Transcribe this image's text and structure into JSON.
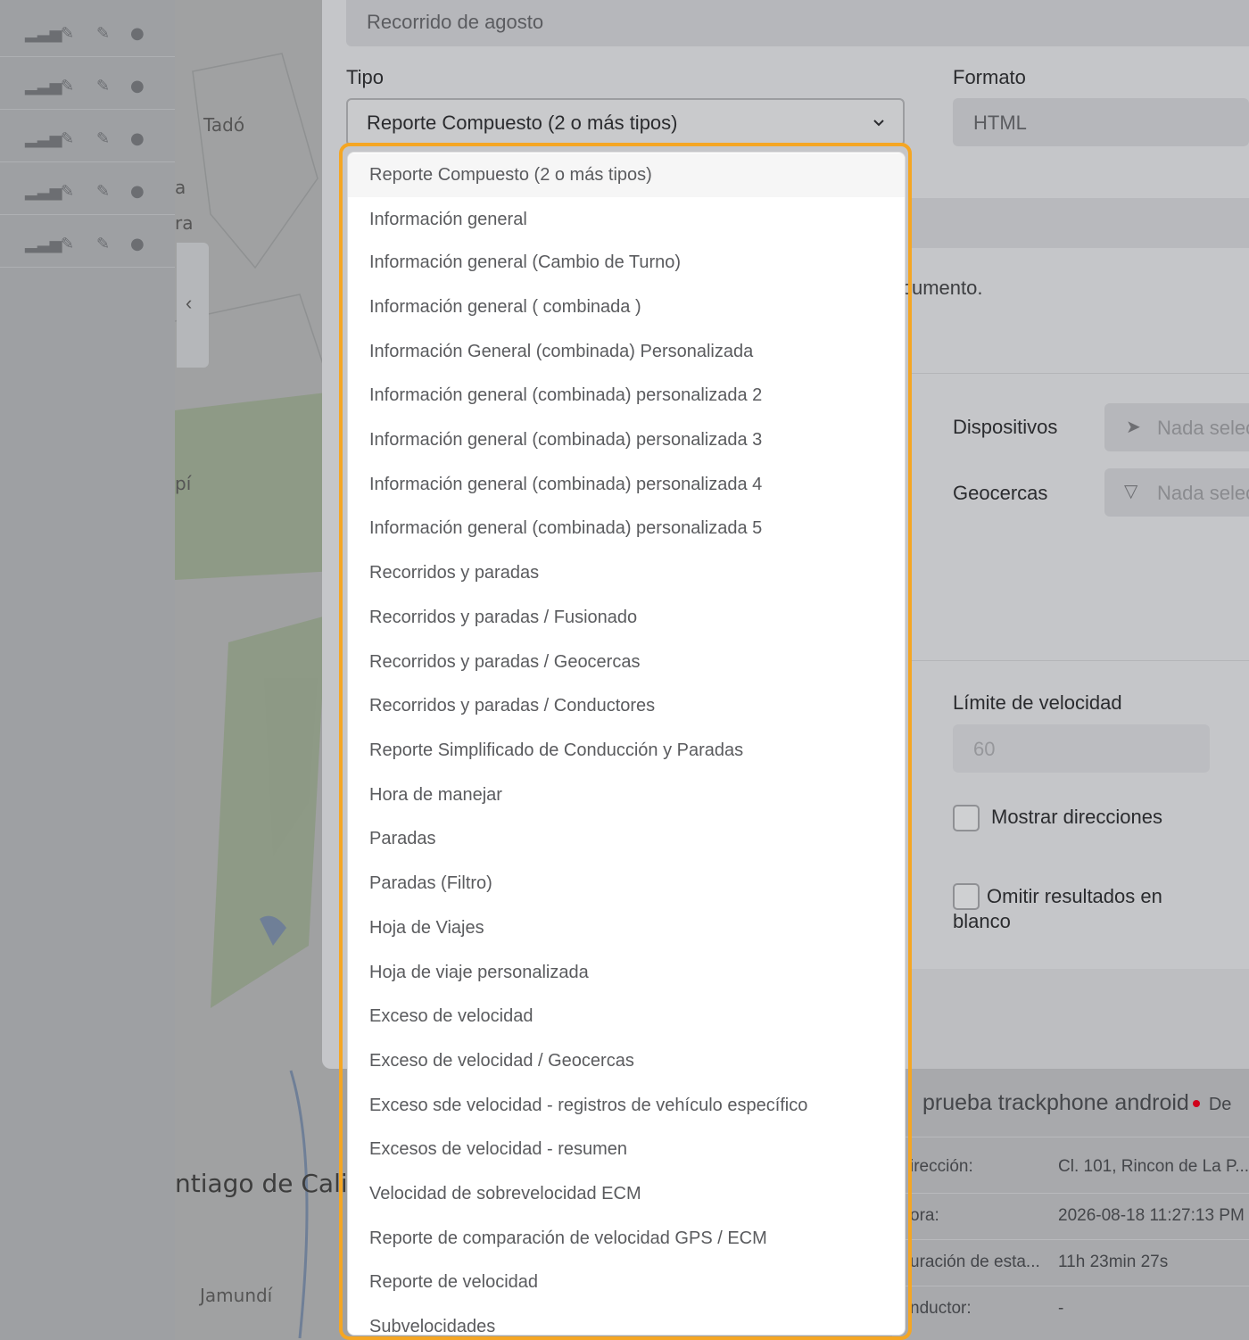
{
  "map": {
    "labels": [
      "Tadó",
      "a",
      "ra",
      "pí",
      "ntiago de Cali",
      "Jamundí"
    ]
  },
  "form": {
    "name_value": "Recorrido de agosto",
    "tipo_label": "Tipo",
    "tipo_value": "Reporte Compuesto (2 o más tipos)",
    "formato_label": "Formato",
    "formato_value": "HTML",
    "documento_text": "cumento.",
    "dispositivos_label": "Dispositivos",
    "dispositivos_value": "Nada selec",
    "geocercas_label": "Geocercas",
    "geocercas_value": "Nada selec",
    "limite_label": "Límite de velocidad",
    "limite_value": "60",
    "mostrar_label": "Mostrar direcciones",
    "omitir_label": "Omitir resultados en blanco"
  },
  "info_panel": {
    "device_name": "prueba trackphone android",
    "suffix": "De",
    "rows": [
      {
        "label": "irección:",
        "value": "Cl. 101, Rincon de La P..."
      },
      {
        "label": "ora:",
        "value": "2026-08-18 11:27:13 PM"
      },
      {
        "label": "uración de esta...",
        "value": "11h 23min 27s"
      },
      {
        "label": "nductor:",
        "value": "-"
      }
    ]
  },
  "dropdown": {
    "options": [
      "Reporte Compuesto (2 o más tipos)",
      "Información general",
      "Información general (Cambio de Turno)",
      "Información general ( combinada )",
      "Información General (combinada) Personalizada",
      "Información general (combinada) personalizada 2",
      "Información general (combinada) personalizada 3",
      "Información general (combinada) personalizada 4",
      "Información general (combinada) personalizada 5",
      "Recorridos y paradas",
      "Recorridos y paradas / Fusionado",
      "Recorridos y paradas / Geocercas",
      "Recorridos y paradas / Conductores",
      "Reporte Simplificado de Conducción y Paradas",
      "Hora de manejar",
      "Paradas",
      "Paradas (Filtro)",
      "Hoja de Viajes",
      "Hoja de viaje personalizada",
      "Exceso de velocidad",
      "Exceso de velocidad / Geocercas",
      "Exceso sde velocidad - registros de vehículo específico",
      "Excesos de velocidad - resumen",
      "Velocidad de sobrevelocidad ECM",
      "Reporte de comparación de velocidad GPS / ECM",
      "Reporte de velocidad",
      "Subvelocidades"
    ]
  },
  "colors": {
    "focus_ring": "#f5a623",
    "status_dot": "#d0021b"
  },
  "icons": [
    "signal-icon",
    "wrench-icon",
    "user-icon",
    "chevron-left-icon",
    "chevron-down-icon",
    "navigation-icon",
    "filter-icon"
  ]
}
